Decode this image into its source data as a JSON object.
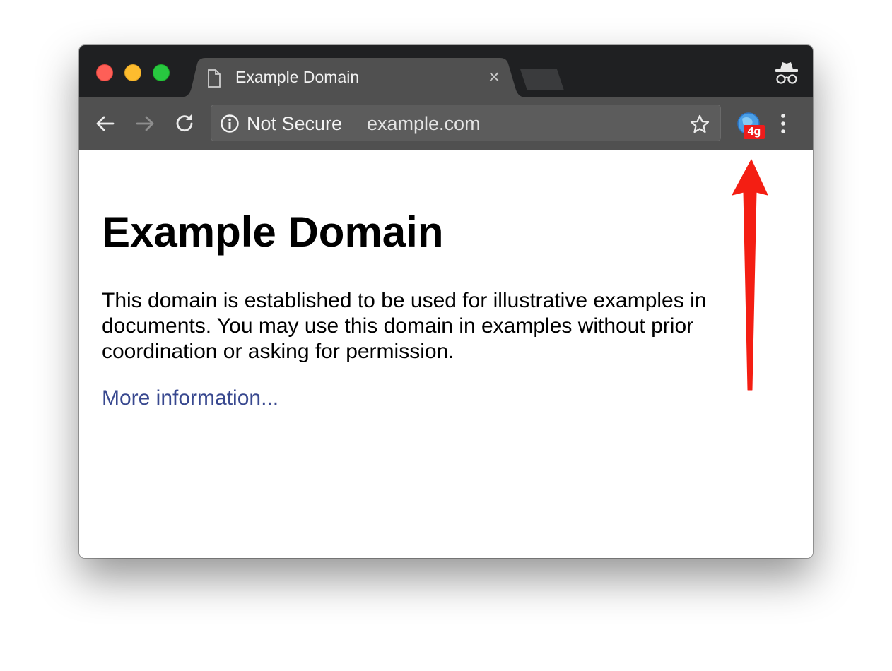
{
  "browser": {
    "tab": {
      "title": "Example Domain",
      "close_glyph": "×"
    },
    "toolbar": {
      "security_label": "Not Secure",
      "url": "example.com",
      "extension_badge": "4g"
    },
    "icons": {
      "document": "document-icon",
      "back": "back-arrow-icon",
      "forward": "forward-arrow-icon",
      "reload": "reload-icon",
      "info": "info-icon",
      "star": "star-icon",
      "extension": "extension-globe-icon",
      "menu": "kebab-menu-icon",
      "incognito": "incognito-icon"
    }
  },
  "page": {
    "heading": "Example Domain",
    "paragraph_lines": [
      "This domain is established to be used for illustrative examples in",
      "documents. You may use this domain in examples without prior",
      "coordination or asking for permission."
    ],
    "link_text": "More information..."
  },
  "colors": {
    "tabstrip_bg": "#1f2022",
    "toolbar_bg": "#505050",
    "link": "#38488f",
    "badge": "#ee1c1c",
    "annotation_arrow": "#f41e13"
  }
}
